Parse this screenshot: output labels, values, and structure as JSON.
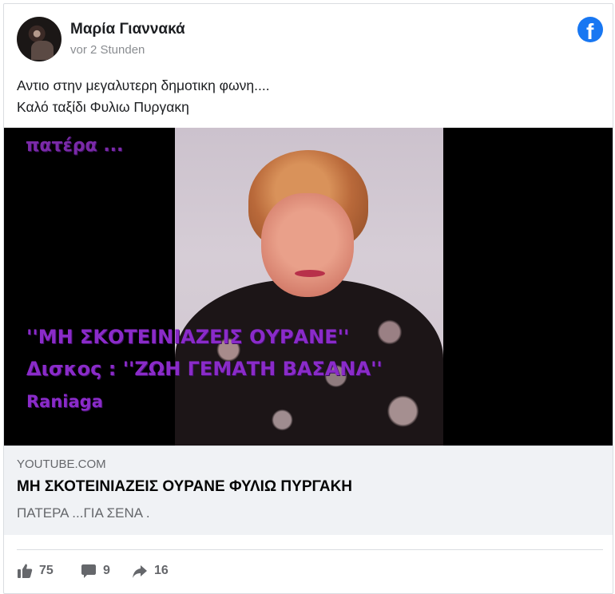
{
  "post": {
    "author": "Μαρία Γιαννακά",
    "timestamp": "vor 2 Stunden",
    "text_lines": [
      "Αντιο στην μεγαλυτερη δημοτικη φωνη....",
      "Καλό ταξίδι Φυλιω Πυργακη"
    ]
  },
  "video_overlay": {
    "line1": "πατέρα ...",
    "line2": "''ΜΗ ΣΚΟΤΕΙΝΙΑΖΕΙΣ ΟΥΡΑΝΕ''",
    "line3": "Δισκος : ''ΖΩΗ ΓΕΜΑΤΗ ΒΑΣΑΝΑ''",
    "line4": "Raniaga"
  },
  "link_preview": {
    "domain": "YOUTUBE.COM",
    "title": "ΜΗ ΣΚΟΤΕΙΝΙΑΖΕΙΣ ΟΥΡΑΝΕ ΦΥΛΙΩ ΠΥΡΓΑΚΗ",
    "description": "ΠΑΤΕΡΑ ...ΓΙΑ ΣΕΝΑ ."
  },
  "reactions": {
    "likes": "75",
    "comments": "9",
    "shares": "16"
  },
  "icons": {
    "brand": "facebook-icon",
    "like": "thumbs-up-icon",
    "comment": "comment-icon",
    "share": "share-arrow-icon"
  },
  "colors": {
    "facebook_blue": "#1877f2",
    "overlay_purple": "#8a2bc9",
    "muted_text": "#65676b"
  }
}
